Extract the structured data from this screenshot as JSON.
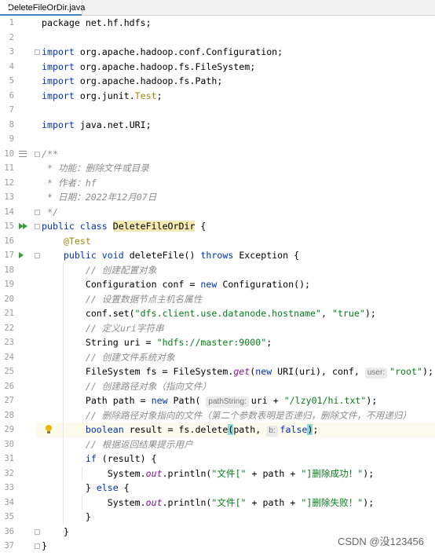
{
  "tab": {
    "filename": "DeleteFileOrDir.java"
  },
  "lines": [
    {
      "n": "1",
      "segs": [
        {
          "t": "package net.hf.hdfs;",
          "c": ""
        }
      ]
    },
    {
      "n": "2",
      "segs": []
    },
    {
      "n": "3",
      "segs": [
        {
          "t": "import",
          "c": "kw"
        },
        {
          "t": " org.apache.hadoop.conf.Configuration;",
          "c": ""
        }
      ]
    },
    {
      "n": "4",
      "segs": [
        {
          "t": "import",
          "c": "kw"
        },
        {
          "t": " org.apache.hadoop.fs.FileSystem;",
          "c": ""
        }
      ]
    },
    {
      "n": "5",
      "segs": [
        {
          "t": "import",
          "c": "kw"
        },
        {
          "t": " org.apache.hadoop.fs.Path;",
          "c": ""
        }
      ]
    },
    {
      "n": "6",
      "segs": [
        {
          "t": "import",
          "c": "kw"
        },
        {
          "t": " org.junit.",
          "c": ""
        },
        {
          "t": "Test",
          "c": "ann"
        },
        {
          "t": ";",
          "c": ""
        }
      ]
    },
    {
      "n": "7",
      "segs": []
    },
    {
      "n": "8",
      "segs": [
        {
          "t": "import",
          "c": "kw"
        },
        {
          "t": " java.net.URI;",
          "c": ""
        }
      ]
    },
    {
      "n": "9",
      "segs": []
    },
    {
      "n": "10",
      "segs": [
        {
          "t": "/**",
          "c": "doc"
        }
      ]
    },
    {
      "n": "11",
      "segs": [
        {
          "t": " * 功能：删除文件或目录",
          "c": "doc"
        }
      ]
    },
    {
      "n": "12",
      "segs": [
        {
          "t": " * 作者：hf",
          "c": "doc"
        }
      ]
    },
    {
      "n": "13",
      "segs": [
        {
          "t": " * 日期：2022年12月07日",
          "c": "doc"
        }
      ]
    },
    {
      "n": "14",
      "segs": [
        {
          "t": " */",
          "c": "doc"
        }
      ]
    },
    {
      "n": "15",
      "segs": [
        {
          "t": "public class ",
          "c": "kw"
        },
        {
          "t": "DeleteFileOrDir",
          "c": "hl-class"
        },
        {
          "t": " {",
          "c": ""
        }
      ]
    },
    {
      "n": "16",
      "segs": [
        {
          "t": "    ",
          "c": ""
        },
        {
          "t": "@Test",
          "c": "ann"
        }
      ]
    },
    {
      "n": "17",
      "segs": [
        {
          "t": "    ",
          "c": ""
        },
        {
          "t": "public void ",
          "c": "kw"
        },
        {
          "t": "deleteFile() ",
          "c": ""
        },
        {
          "t": "throws ",
          "c": "kw"
        },
        {
          "t": "Exception {",
          "c": ""
        }
      ]
    },
    {
      "n": "18",
      "segs": [
        {
          "t": "        ",
          "c": ""
        },
        {
          "t": "// 创建配置对象",
          "c": "cmt"
        }
      ]
    },
    {
      "n": "19",
      "segs": [
        {
          "t": "        Configuration conf = ",
          "c": ""
        },
        {
          "t": "new ",
          "c": "kw"
        },
        {
          "t": "Configuration();",
          "c": ""
        }
      ]
    },
    {
      "n": "20",
      "segs": [
        {
          "t": "        ",
          "c": ""
        },
        {
          "t": "// 设置数据节点主机名属性",
          "c": "cmt"
        }
      ]
    },
    {
      "n": "21",
      "segs": [
        {
          "t": "        conf.set(",
          "c": ""
        },
        {
          "t": "\"dfs.client.use.datanode.hostname\"",
          "c": "str"
        },
        {
          "t": ", ",
          "c": ""
        },
        {
          "t": "\"true\"",
          "c": "str"
        },
        {
          "t": ");",
          "c": ""
        }
      ]
    },
    {
      "n": "22",
      "segs": [
        {
          "t": "        ",
          "c": ""
        },
        {
          "t": "// 定义uri字符串",
          "c": "cmt"
        }
      ]
    },
    {
      "n": "23",
      "segs": [
        {
          "t": "        String uri = ",
          "c": ""
        },
        {
          "t": "\"hdfs://master:9000\"",
          "c": "str"
        },
        {
          "t": ";",
          "c": ""
        }
      ]
    },
    {
      "n": "24",
      "segs": [
        {
          "t": "        ",
          "c": ""
        },
        {
          "t": "// 创建文件系统对象",
          "c": "cmt"
        }
      ]
    },
    {
      "n": "25",
      "segs": [
        {
          "t": "        FileSystem fs = FileSystem.",
          "c": ""
        },
        {
          "t": "get",
          "c": "fld"
        },
        {
          "t": "(",
          "c": ""
        },
        {
          "t": "new ",
          "c": "kw"
        },
        {
          "t": "URI(uri), conf, ",
          "c": ""
        },
        {
          "t": "user:",
          "c": "hint"
        },
        {
          "t": "\"root\"",
          "c": "str"
        },
        {
          "t": ");",
          "c": ""
        }
      ]
    },
    {
      "n": "26",
      "segs": [
        {
          "t": "        ",
          "c": ""
        },
        {
          "t": "// 创建路径对象（指向文件）",
          "c": "cmt"
        }
      ]
    },
    {
      "n": "27",
      "segs": [
        {
          "t": "        Path path = ",
          "c": ""
        },
        {
          "t": "new ",
          "c": "kw"
        },
        {
          "t": "Path( ",
          "c": ""
        },
        {
          "t": "pathString:",
          "c": "hint"
        },
        {
          "t": "uri + ",
          "c": ""
        },
        {
          "t": "\"/lzy01/hi.txt\"",
          "c": "str"
        },
        {
          "t": ");",
          "c": ""
        }
      ]
    },
    {
      "n": "28",
      "segs": [
        {
          "t": "        ",
          "c": ""
        },
        {
          "t": "// 删除路径对象指向的文件（第二个参数表明是否递归，删除文件，不用递归）",
          "c": "cmt"
        }
      ]
    },
    {
      "n": "29",
      "segs": [
        {
          "t": "        ",
          "c": ""
        },
        {
          "t": "boolean ",
          "c": "kw"
        },
        {
          "t": "result = fs.delete",
          "c": ""
        },
        {
          "t": "(",
          "c": "brace-hl"
        },
        {
          "t": "path, ",
          "c": ""
        },
        {
          "t": "b:",
          "c": "hint"
        },
        {
          "t": "false",
          "c": "kw"
        },
        {
          "t": ")",
          "c": "brace-hl"
        },
        {
          "t": ";",
          "c": ""
        }
      ]
    },
    {
      "n": "30",
      "segs": [
        {
          "t": "        ",
          "c": ""
        },
        {
          "t": "// 根据返回结果提示用户",
          "c": "cmt"
        }
      ]
    },
    {
      "n": "31",
      "segs": [
        {
          "t": "        ",
          "c": ""
        },
        {
          "t": "if ",
          "c": "kw"
        },
        {
          "t": "(result) {",
          "c": ""
        }
      ]
    },
    {
      "n": "32",
      "segs": [
        {
          "t": "            System.",
          "c": ""
        },
        {
          "t": "out",
          "c": "fld"
        },
        {
          "t": ".println(",
          "c": ""
        },
        {
          "t": "\"文件[\"",
          "c": "str"
        },
        {
          "t": " + path + ",
          "c": ""
        },
        {
          "t": "\"]删除成功！\"",
          "c": "str"
        },
        {
          "t": ");",
          "c": ""
        }
      ]
    },
    {
      "n": "33",
      "segs": [
        {
          "t": "        } ",
          "c": ""
        },
        {
          "t": "else ",
          "c": "kw"
        },
        {
          "t": "{",
          "c": ""
        }
      ]
    },
    {
      "n": "34",
      "segs": [
        {
          "t": "            System.",
          "c": ""
        },
        {
          "t": "out",
          "c": "fld"
        },
        {
          "t": ".println(",
          "c": ""
        },
        {
          "t": "\"文件[\"",
          "c": "str"
        },
        {
          "t": " + path + ",
          "c": ""
        },
        {
          "t": "\"]删除失败！\"",
          "c": "str"
        },
        {
          "t": ");",
          "c": ""
        }
      ]
    },
    {
      "n": "35",
      "segs": [
        {
          "t": "        }",
          "c": ""
        }
      ]
    },
    {
      "n": "36",
      "segs": [
        {
          "t": "    }",
          "c": ""
        }
      ]
    },
    {
      "n": "37",
      "segs": [
        {
          "t": "}",
          "c": ""
        }
      ]
    }
  ],
  "watermark": "CSDN @没123456"
}
